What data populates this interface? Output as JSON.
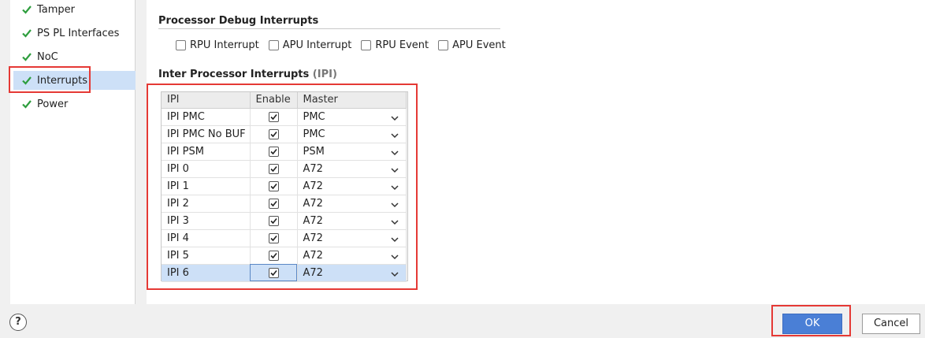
{
  "sidebar": {
    "items": [
      {
        "label": "Tamper"
      },
      {
        "label": "PS PL Interfaces"
      },
      {
        "label": "NoC"
      },
      {
        "label": "Interrupts"
      },
      {
        "label": "Power"
      }
    ],
    "selected": "Interrupts"
  },
  "debug_section": {
    "title": "Processor Debug Interrupts",
    "options": [
      {
        "label": "RPU Interrupt",
        "checked": false
      },
      {
        "label": "APU Interrupt",
        "checked": false
      },
      {
        "label": "RPU Event",
        "checked": false
      },
      {
        "label": "APU Event",
        "checked": false
      }
    ]
  },
  "ipi_section": {
    "title": "Inter Processor Interrupts",
    "title_suffix": "(IPI)",
    "columns": [
      "IPI",
      "Enable",
      "Master"
    ],
    "rows": [
      {
        "ipi": "IPI PMC",
        "enabled": true,
        "master": "PMC"
      },
      {
        "ipi": "IPI PMC No BUF",
        "enabled": true,
        "master": "PMC"
      },
      {
        "ipi": "IPI PSM",
        "enabled": true,
        "master": "PSM"
      },
      {
        "ipi": "IPI 0",
        "enabled": true,
        "master": "A72"
      },
      {
        "ipi": "IPI 1",
        "enabled": true,
        "master": "A72"
      },
      {
        "ipi": "IPI 2",
        "enabled": true,
        "master": "A72"
      },
      {
        "ipi": "IPI 3",
        "enabled": true,
        "master": "A72"
      },
      {
        "ipi": "IPI 4",
        "enabled": true,
        "master": "A72"
      },
      {
        "ipi": "IPI 5",
        "enabled": true,
        "master": "A72"
      },
      {
        "ipi": "IPI 6",
        "enabled": true,
        "master": "A72"
      }
    ],
    "selected_row": "IPI 6"
  },
  "footer": {
    "help_label": "?",
    "ok_label": "OK",
    "cancel_label": "Cancel"
  },
  "colors": {
    "accent": "#4a7fd6",
    "selection": "#cde0f7",
    "highlight_box": "#e53935",
    "check_green": "#2e9e3e"
  }
}
